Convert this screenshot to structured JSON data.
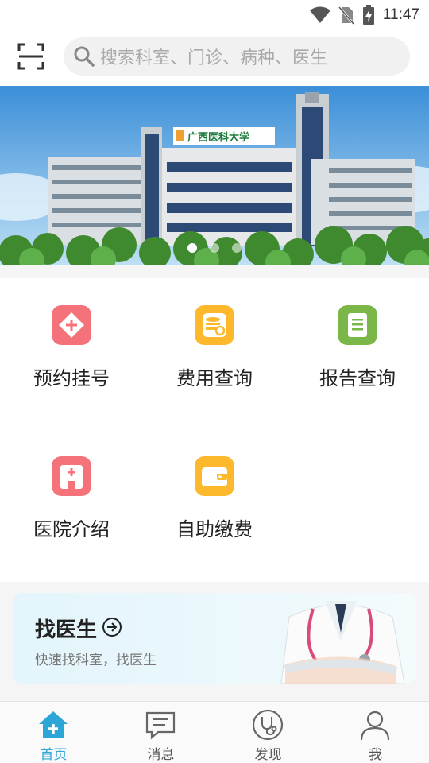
{
  "status_bar": {
    "time": "11:47"
  },
  "search": {
    "placeholder": "搜索科室、门诊、病种、医生"
  },
  "banner": {
    "sign_text": "广西医科大学",
    "slides": 3,
    "active_slide": 1
  },
  "services": [
    {
      "label": "预约挂号",
      "icon": "appointment-icon",
      "color": "#f4737a"
    },
    {
      "label": "费用查询",
      "icon": "fee-query-icon",
      "color": "#fdb82c"
    },
    {
      "label": "报告查询",
      "icon": "report-query-icon",
      "color": "#7ab648"
    },
    {
      "label": "医院介绍",
      "icon": "hospital-intro-icon",
      "color": "#f4737a"
    },
    {
      "label": "自助缴费",
      "icon": "self-payment-icon",
      "color": "#fdb82c"
    }
  ],
  "doctor_card": {
    "title": "找医生",
    "subtitle": "快速找科室，找医生"
  },
  "tabbar": {
    "items": [
      {
        "label": "首页",
        "icon": "home-icon",
        "active": true
      },
      {
        "label": "消息",
        "icon": "message-icon",
        "active": false
      },
      {
        "label": "发现",
        "icon": "stethoscope-icon",
        "active": false
      },
      {
        "label": "我",
        "icon": "profile-icon",
        "active": false
      }
    ],
    "active_color": "#2ba6d6"
  }
}
